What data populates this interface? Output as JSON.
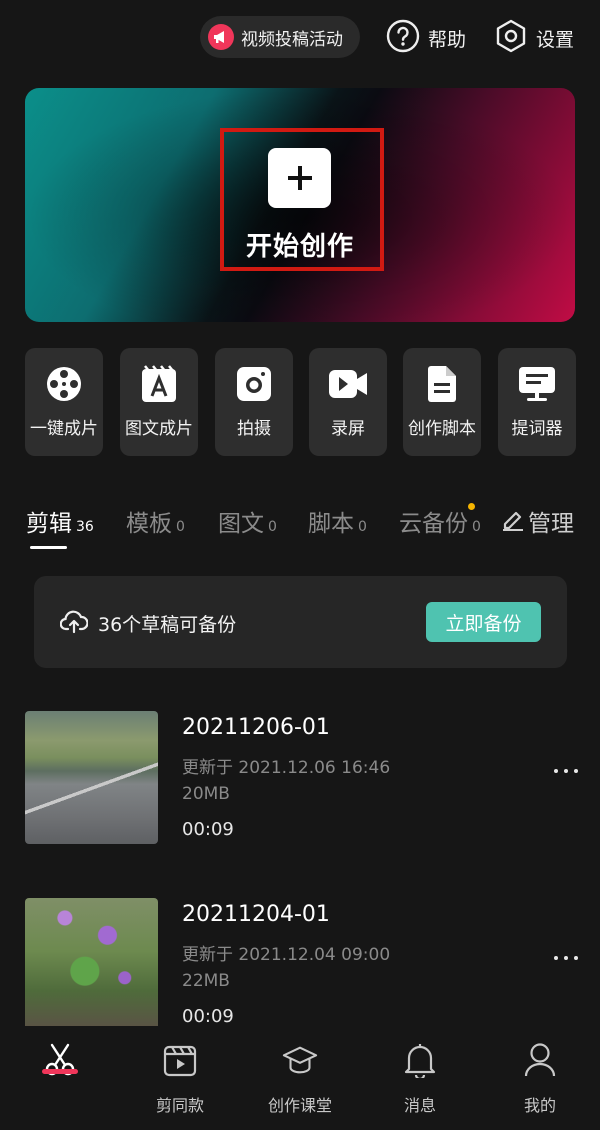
{
  "header": {
    "promo_label": "视频投稿活动",
    "help_label": "帮助",
    "settings_label": "设置"
  },
  "hero": {
    "create_label": "开始创作",
    "plus_symbol": "+"
  },
  "tools": [
    {
      "label": "一键成片",
      "icon": "film-reel-icon"
    },
    {
      "label": "图文成片",
      "icon": "text-image-icon"
    },
    {
      "label": "拍摄",
      "icon": "camera-icon"
    },
    {
      "label": "录屏",
      "icon": "screen-record-icon"
    },
    {
      "label": "创作脚本",
      "icon": "script-document-icon"
    },
    {
      "label": "提词器",
      "icon": "teleprompter-icon"
    }
  ],
  "tabs": [
    {
      "label": "剪辑",
      "count": "36",
      "active": true
    },
    {
      "label": "模板",
      "count": "0"
    },
    {
      "label": "图文",
      "count": "0"
    },
    {
      "label": "脚本",
      "count": "0"
    },
    {
      "label": "云备份",
      "count": "0",
      "has_dot": true
    }
  ],
  "manage_label": "管理",
  "backup": {
    "message": "36个草稿可备份",
    "button_label": "立即备份"
  },
  "drafts": [
    {
      "title": "20211206-01",
      "updated": "更新于 2021.12.06 16:46",
      "size": "20MB",
      "duration": "00:09"
    },
    {
      "title": "20211204-01",
      "updated": "更新于 2021.12.04 09:00",
      "size": "22MB",
      "duration": "00:09"
    }
  ],
  "bottom_nav": [
    {
      "label": "",
      "icon": "scissors-icon",
      "active": true
    },
    {
      "label": "剪同款",
      "icon": "template-clapper-icon"
    },
    {
      "label": "创作课堂",
      "icon": "graduation-cap-icon"
    },
    {
      "label": "消息",
      "icon": "bell-icon"
    },
    {
      "label": "我的",
      "icon": "profile-icon"
    }
  ],
  "colors": {
    "background": "#161616",
    "accent_red": "#f0365a",
    "backup_button": "#4fc3b0",
    "badge_dot": "#f5b400",
    "highlight_frame": "#d11a12"
  }
}
